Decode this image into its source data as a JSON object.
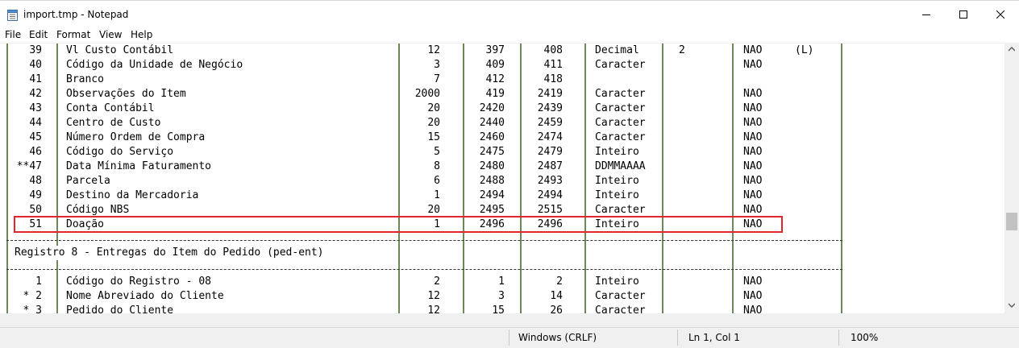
{
  "window": {
    "title": "import.tmp - Notepad",
    "icon": "notepad-icon",
    "buttons": [
      "minimize-icon",
      "maximize-icon",
      "close-icon"
    ]
  },
  "menu": {
    "file": "File",
    "edit": "Edit",
    "format": "Format",
    "view": "View",
    "help": "Help"
  },
  "rows": [
    {
      "n": "39",
      "desc": "Vl Custo Contábil",
      "size": "12",
      "start": "397",
      "end": "408",
      "type": "Decimal",
      "dec": "2",
      "req": "NAO",
      "extra": "(L)"
    },
    {
      "n": "40",
      "desc": "Código da Unidade de Negócio",
      "size": "3",
      "start": "409",
      "end": "411",
      "type": "Caracter",
      "dec": "",
      "req": "NAO",
      "extra": ""
    },
    {
      "n": "41",
      "desc": "Branco",
      "size": "7",
      "start": "412",
      "end": "418",
      "type": "",
      "dec": "",
      "req": "",
      "extra": ""
    },
    {
      "n": "42",
      "desc": "Observações do Item",
      "size": "2000",
      "start": "419",
      "end": "2419",
      "type": "Caracter",
      "dec": "",
      "req": "NAO",
      "extra": ""
    },
    {
      "n": "43",
      "desc": "Conta Contábil",
      "size": "20",
      "start": "2420",
      "end": "2439",
      "type": "Caracter",
      "dec": "",
      "req": "NAO",
      "extra": ""
    },
    {
      "n": "44",
      "desc": "Centro de Custo",
      "size": "20",
      "start": "2440",
      "end": "2459",
      "type": "Caracter",
      "dec": "",
      "req": "NAO",
      "extra": ""
    },
    {
      "n": "45",
      "desc": "Número Ordem de Compra",
      "size": "15",
      "start": "2460",
      "end": "2474",
      "type": "Caracter",
      "dec": "",
      "req": "NAO",
      "extra": ""
    },
    {
      "n": "46",
      "desc": "Código do Serviço",
      "size": "5",
      "start": "2475",
      "end": "2479",
      "type": "Inteiro",
      "dec": "",
      "req": "NAO",
      "extra": ""
    },
    {
      "n": "**47",
      "desc": "Data Mínima Faturamento",
      "size": "8",
      "start": "2480",
      "end": "2487",
      "type": "DDMMAAAA",
      "dec": "",
      "req": "NAO",
      "extra": ""
    },
    {
      "n": "48",
      "desc": "Parcela",
      "size": "6",
      "start": "2488",
      "end": "2493",
      "type": "Inteiro",
      "dec": "",
      "req": "NAO",
      "extra": ""
    },
    {
      "n": "49",
      "desc": "Destino da Mercadoria",
      "size": "1",
      "start": "2494",
      "end": "2494",
      "type": "Inteiro",
      "dec": "",
      "req": "NAO",
      "extra": ""
    },
    {
      "n": "50",
      "desc": "Código NBS",
      "size": "20",
      "start": "2495",
      "end": "2515",
      "type": "Caracter",
      "dec": "",
      "req": "NAO",
      "extra": ""
    },
    {
      "n": "51",
      "desc": "Doação",
      "size": "1",
      "start": "2496",
      "end": "2496",
      "type": "Inteiro",
      "dec": "",
      "req": "NAO",
      "extra": ""
    }
  ],
  "section_title": "Registro 8 - Entregas do Item do Pedido (ped-ent)",
  "rows2": [
    {
      "n": "1",
      "desc": "Código do Registro - 08",
      "size": "2",
      "start": "1",
      "end": "2",
      "type": "Inteiro",
      "dec": "",
      "req": "NAO",
      "extra": ""
    },
    {
      "n": "* 2",
      "desc": "Nome Abreviado do Cliente",
      "size": "12",
      "start": "3",
      "end": "14",
      "type": "Caracter",
      "dec": "",
      "req": "NAO",
      "extra": ""
    },
    {
      "n": "* 3",
      "desc": "Pedido do Cliente",
      "size": "12",
      "start": "15",
      "end": "26",
      "type": "Caracter",
      "dec": "",
      "req": "NAO",
      "extra": ""
    }
  ],
  "status": {
    "encoding": "Windows (CRLF)",
    "position": "Ln 1, Col 1",
    "zoom": "100%"
  },
  "colors": {
    "highlight": "#e3262b",
    "column_rule": "#6b8a5a"
  }
}
